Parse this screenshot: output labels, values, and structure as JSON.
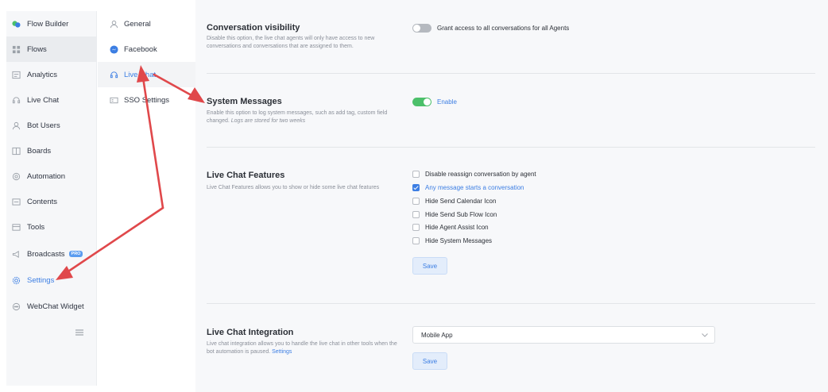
{
  "sidebar": {
    "items": [
      {
        "label": "Flow Builder",
        "icon": "flow-builder-icon"
      },
      {
        "label": "Flows",
        "icon": "flows-icon"
      },
      {
        "label": "Analytics",
        "icon": "analytics-icon"
      },
      {
        "label": "Live Chat",
        "icon": "headset-icon"
      },
      {
        "label": "Bot Users",
        "icon": "user-icon"
      },
      {
        "label": "Boards",
        "icon": "boards-icon"
      },
      {
        "label": "Automation",
        "icon": "automation-icon"
      },
      {
        "label": "Contents",
        "icon": "contents-icon"
      },
      {
        "label": "Tools",
        "icon": "tools-icon"
      },
      {
        "label": "Broadcasts",
        "icon": "megaphone-icon",
        "badge": "PRO"
      },
      {
        "label": "Settings",
        "icon": "gear-icon"
      },
      {
        "label": "WebChat Widget",
        "icon": "chat-bubble-icon"
      }
    ],
    "collapse_icon": "hamburger-icon"
  },
  "submenu": {
    "items": [
      {
        "label": "General",
        "icon": "user-icon"
      },
      {
        "label": "Facebook",
        "icon": "messenger-icon"
      },
      {
        "label": "Live Chat",
        "icon": "headset-icon"
      },
      {
        "label": "SSO Settings",
        "icon": "id-card-icon"
      }
    ]
  },
  "main": {
    "visibility": {
      "title": "Conversation visibility",
      "desc": "Disable this option, the live chat agents will only have access to new conversations and conversations that are assigned to them.",
      "toggle_label": "Grant access to all conversations for all Agents",
      "enabled": false
    },
    "system_messages": {
      "title": "System Messages",
      "desc_plain": "Enable this option to log system messages, such as add tag, custom field changed.",
      "desc_italic": "Logs are stored for two weeks",
      "toggle_label": "Enable",
      "enabled": true
    },
    "features": {
      "title": "Live Chat Features",
      "desc": "Live Chat Features allows you to show or hide some live chat features",
      "options": [
        {
          "label": "Disable reassign conversation by agent",
          "checked": false
        },
        {
          "label": "Any message starts a conversation",
          "checked": true
        },
        {
          "label": "Hide Send Calendar Icon",
          "checked": false
        },
        {
          "label": "Hide Send Sub Flow Icon",
          "checked": false
        },
        {
          "label": "Hide Agent Assist Icon",
          "checked": false
        },
        {
          "label": "Hide System Messages",
          "checked": false
        }
      ],
      "save_label": "Save"
    },
    "integration": {
      "title": "Live Chat Integration",
      "desc_plain": "Live chat integration allows you to handle the live chat in other tools when the bot automation is paused.",
      "desc_link": "Settings",
      "selected": "Mobile App",
      "save_label": "Save"
    }
  },
  "colors": {
    "accent": "#3c7ee3",
    "toggle_on": "#4cc06a",
    "toggle_off": "#b5b9bf",
    "annotation_arrow": "#e0484b"
  }
}
